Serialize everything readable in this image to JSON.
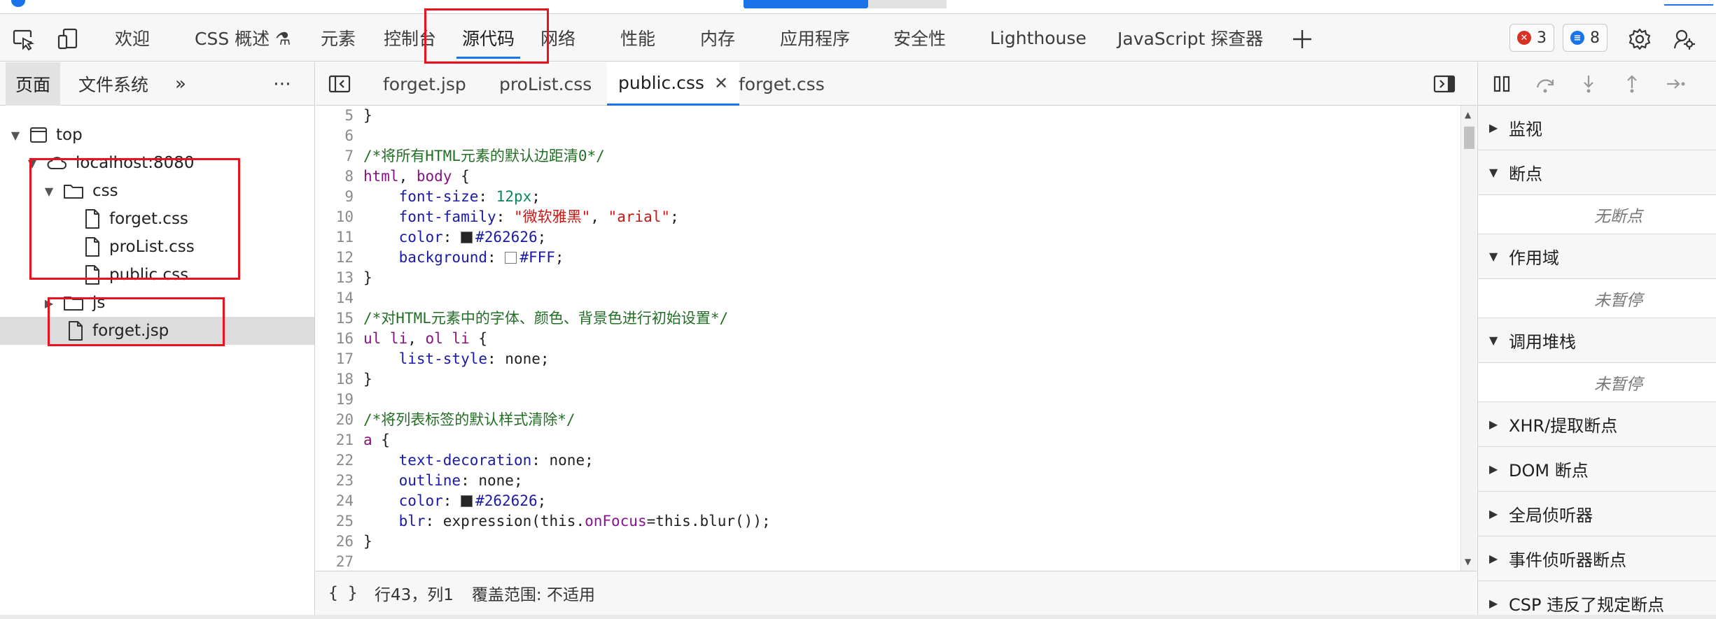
{
  "toolbar": {
    "tabs": [
      {
        "label": "欢迎"
      },
      {
        "label": "CSS 概述 ⚗"
      },
      {
        "label": "元素"
      },
      {
        "label": "控制台"
      },
      {
        "label": "源代码"
      },
      {
        "label": "网络"
      },
      {
        "label": "性能"
      },
      {
        "label": "内存"
      },
      {
        "label": "应用程序"
      },
      {
        "label": "安全性"
      },
      {
        "label": "Lighthouse"
      },
      {
        "label": "JavaScript 探查器"
      }
    ],
    "active_tab": "源代码",
    "errors_count": "3",
    "messages_count": "8",
    "colors": {
      "accent": "#1a73e8",
      "error": "#d93025",
      "message": "#1a73e8",
      "annotation": "#e8131f"
    }
  },
  "navigator": {
    "tabs": [
      {
        "label": "页面"
      },
      {
        "label": "文件系统"
      }
    ],
    "tree": [
      {
        "label": "top"
      },
      {
        "label": "localhost:8080"
      },
      {
        "label": "css"
      },
      {
        "label": "forget.css"
      },
      {
        "label": "proList.css"
      },
      {
        "label": "public.css"
      },
      {
        "label": "js"
      },
      {
        "label": "forget.jsp"
      }
    ]
  },
  "editor": {
    "tabs": [
      {
        "label": "forget.jsp"
      },
      {
        "label": "proList.css"
      },
      {
        "label": "public.css"
      },
      {
        "label": "forget.css"
      }
    ],
    "active_tab": "public.css",
    "lines": [
      {
        "n": "5",
        "text": "}"
      },
      {
        "n": "6",
        "text": ""
      },
      {
        "n": "7",
        "text": "/*将所有HTML元素的默认边距清0*/"
      },
      {
        "n": "8",
        "text": "html, body {"
      },
      {
        "n": "9",
        "text": "    font-size: 12px;"
      },
      {
        "n": "10",
        "text": "    font-family: \"微软雅黑\", \"arial\";"
      },
      {
        "n": "11",
        "text": "    color: #262626;"
      },
      {
        "n": "12",
        "text": "    background: #FFF;"
      },
      {
        "n": "13",
        "text": "}"
      },
      {
        "n": "14",
        "text": ""
      },
      {
        "n": "15",
        "text": "/*对HTML元素中的字体、颜色、背景色进行初始设置*/"
      },
      {
        "n": "16",
        "text": "ul li, ol li {"
      },
      {
        "n": "17",
        "text": "    list-style: none;"
      },
      {
        "n": "18",
        "text": "}"
      },
      {
        "n": "19",
        "text": ""
      },
      {
        "n": "20",
        "text": "/*将列表标签的默认样式清除*/"
      },
      {
        "n": "21",
        "text": "a {"
      },
      {
        "n": "22",
        "text": "    text-decoration: none;"
      },
      {
        "n": "23",
        "text": "    outline: none;"
      },
      {
        "n": "24",
        "text": "    color: #262626;"
      },
      {
        "n": "25",
        "text": "    blr: expression(this.onFocus=this.blur());"
      },
      {
        "n": "26",
        "text": "}"
      },
      {
        "n": "27",
        "text": ""
      }
    ],
    "status": {
      "format_glyph": "{ }",
      "position": "行43，列1",
      "coverage": "覆盖范围: 不适用"
    }
  },
  "debugger": {
    "panes": [
      {
        "label": "监视",
        "expanded": false
      },
      {
        "label": "断点",
        "expanded": true,
        "body": "无断点"
      },
      {
        "label": "作用域",
        "expanded": true,
        "body": "未暂停"
      },
      {
        "label": "调用堆栈",
        "expanded": true,
        "body": "未暂停"
      },
      {
        "label": "XHR/提取断点",
        "expanded": false
      },
      {
        "label": "DOM 断点",
        "expanded": false
      },
      {
        "label": "全局侦听器",
        "expanded": false
      },
      {
        "label": "事件侦听器断点",
        "expanded": false
      },
      {
        "label": "CSP 违反了规定断点",
        "expanded": false
      }
    ]
  }
}
